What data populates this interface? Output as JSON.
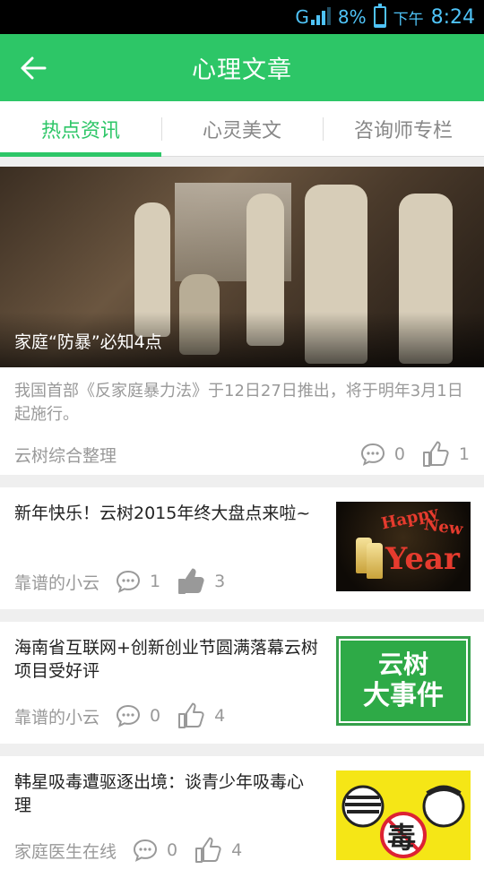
{
  "status_bar": {
    "network": "G",
    "battery_percent_text": "8%",
    "battery_level": 0.08,
    "time_prefix": "下午",
    "time": "8:24"
  },
  "app_bar": {
    "title": "心理文章",
    "back_icon": "arrow-left-icon"
  },
  "tabs": [
    {
      "label": "热点资讯",
      "active": true
    },
    {
      "label": "心灵美文",
      "active": false
    },
    {
      "label": "咨询师专栏",
      "active": false
    }
  ],
  "colors": {
    "accent": "#2dc667",
    "text_primary": "#222222",
    "text_secondary": "#999999",
    "background": "#efefef"
  },
  "featured": {
    "image_caption": "家庭“防暴”必知4点",
    "summary": "我国首部《反家庭暴力法》于12日27日推出，将于明年3月1日起施行。",
    "author": "云树综合整理",
    "comments": "0",
    "likes": "1"
  },
  "articles": [
    {
      "headline": "新年快乐！云树2015年终大盘点来啦~",
      "author": "靠谱的小云",
      "comments": "1",
      "likes": "3",
      "liked": true,
      "thumb_text": [
        "Happy",
        "New",
        "Year"
      ]
    },
    {
      "headline": "海南省互联网+创新创业节圆满落幕云树项目受好评",
      "author": "靠谱的小云",
      "comments": "0",
      "likes": "4",
      "liked": false,
      "thumb_text": [
        "云树",
        "大事件"
      ]
    },
    {
      "headline": "韩星吸毒遭驱逐出境：谈青少年吸毒心理",
      "author": "家庭医生在线",
      "comments": "0",
      "likes": "4",
      "liked": false,
      "thumb_text": [
        "毒"
      ]
    }
  ]
}
